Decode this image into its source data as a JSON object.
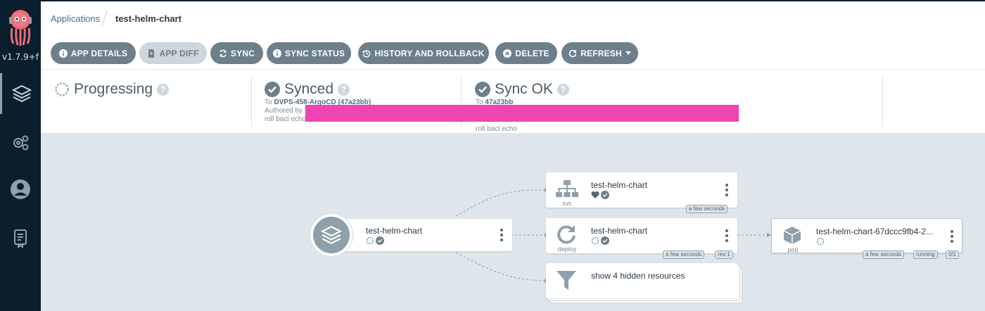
{
  "sidebar": {
    "version": "v1.7.9+f"
  },
  "breadcrumb": {
    "applications": "Applications",
    "current": "test-helm-chart"
  },
  "toolbar": {
    "app_details": "APP DETAILS",
    "app_diff": "APP DIFF",
    "sync": "SYNC",
    "sync_status": "SYNC STATUS",
    "history": "HISTORY AND ROLLBACK",
    "delete": "DELETE",
    "refresh": "REFRESH"
  },
  "status": {
    "health": {
      "title": "Progressing"
    },
    "sync": {
      "title": "Synced",
      "to_label": "To",
      "to_value": "DVPS-458-ArgoCD (47a23bb)",
      "authored": "Authored by",
      "message": "roll bacl echo"
    },
    "operation": {
      "title": "Sync OK",
      "to_label": "To",
      "to_value": "47a23bb",
      "message": "roll bacl echo"
    }
  },
  "tree": {
    "app": {
      "name": "test-helm-chart"
    },
    "svc": {
      "name": "test-helm-chart",
      "kind": "svc",
      "tags": [
        "a few seconds"
      ]
    },
    "deploy": {
      "name": "test-helm-chart",
      "kind": "deploy",
      "tags": [
        "a few seconds",
        "rev:1"
      ]
    },
    "pod": {
      "name": "test-helm-chart-67dccc9fb4-2...",
      "kind": "pod",
      "tags": [
        "a few seconds",
        "running",
        "0/1"
      ]
    },
    "hidden": {
      "label": "show 4 hidden resources"
    }
  },
  "colors": {
    "sidebar": "#0b1e2d",
    "button": "#6d7f8b",
    "healthy_green": "#18be94",
    "progressing": "#0dadea",
    "redaction": "#ee45b1"
  }
}
